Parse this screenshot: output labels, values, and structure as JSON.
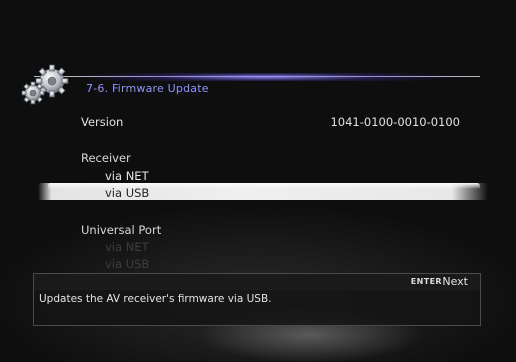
{
  "header": {
    "title": "7-6. Firmware Update",
    "icon": "gears-icon"
  },
  "version": {
    "label": "Version",
    "value": "1041-0100-0010-0100"
  },
  "receiver": {
    "label": "Receiver",
    "items": [
      {
        "label": "via NET",
        "selected": false
      },
      {
        "label": "via USB",
        "selected": true
      }
    ]
  },
  "universal_port": {
    "label": "Universal Port",
    "items": [
      {
        "label": "via NET",
        "enabled": false
      },
      {
        "label": "via USB",
        "enabled": false
      }
    ]
  },
  "help": {
    "key": "ENTER",
    "action": "Next",
    "description": "Updates the AV receiver's firmware via USB."
  },
  "colors": {
    "title_text": "#8e95ff",
    "selection_bar": "#e4e4e4",
    "disabled_text": "#3e3e3e"
  }
}
